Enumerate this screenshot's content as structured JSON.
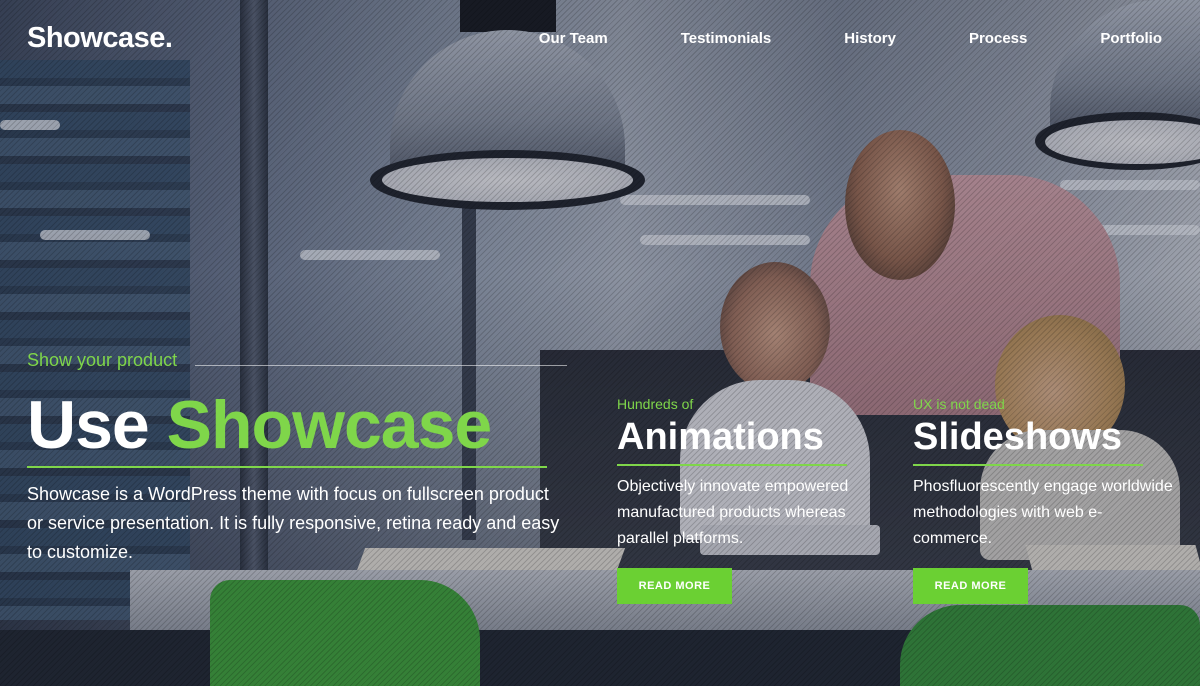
{
  "brand": {
    "logo": "Showcase."
  },
  "nav": {
    "items": [
      {
        "label": "Our Team"
      },
      {
        "label": "Testimonials"
      },
      {
        "label": "History"
      },
      {
        "label": "Process"
      },
      {
        "label": "Portfolio"
      }
    ]
  },
  "hero": {
    "kicker": "Show your product",
    "title_plain": "Use",
    "title_highlight": "Showcase",
    "body": "Showcase is a WordPress theme with focus on fullscreen product or service presentation. It is fully responsive, retina ready and easy to customize."
  },
  "features": [
    {
      "kicker": "Hundreds of",
      "title": "Animations",
      "body": "Objectively innovate empowered manufactured products whereas parallel platforms.",
      "button": "READ MORE"
    },
    {
      "kicker": "UX is not dead",
      "title": "Slideshows",
      "body": "Phosfluorescently engage worldwide methodologies with web e-commerce.",
      "button": "READ MORE"
    }
  ],
  "colors": {
    "accent": "#7fd64a",
    "button": "#6bd033",
    "text": "#ffffff"
  }
}
